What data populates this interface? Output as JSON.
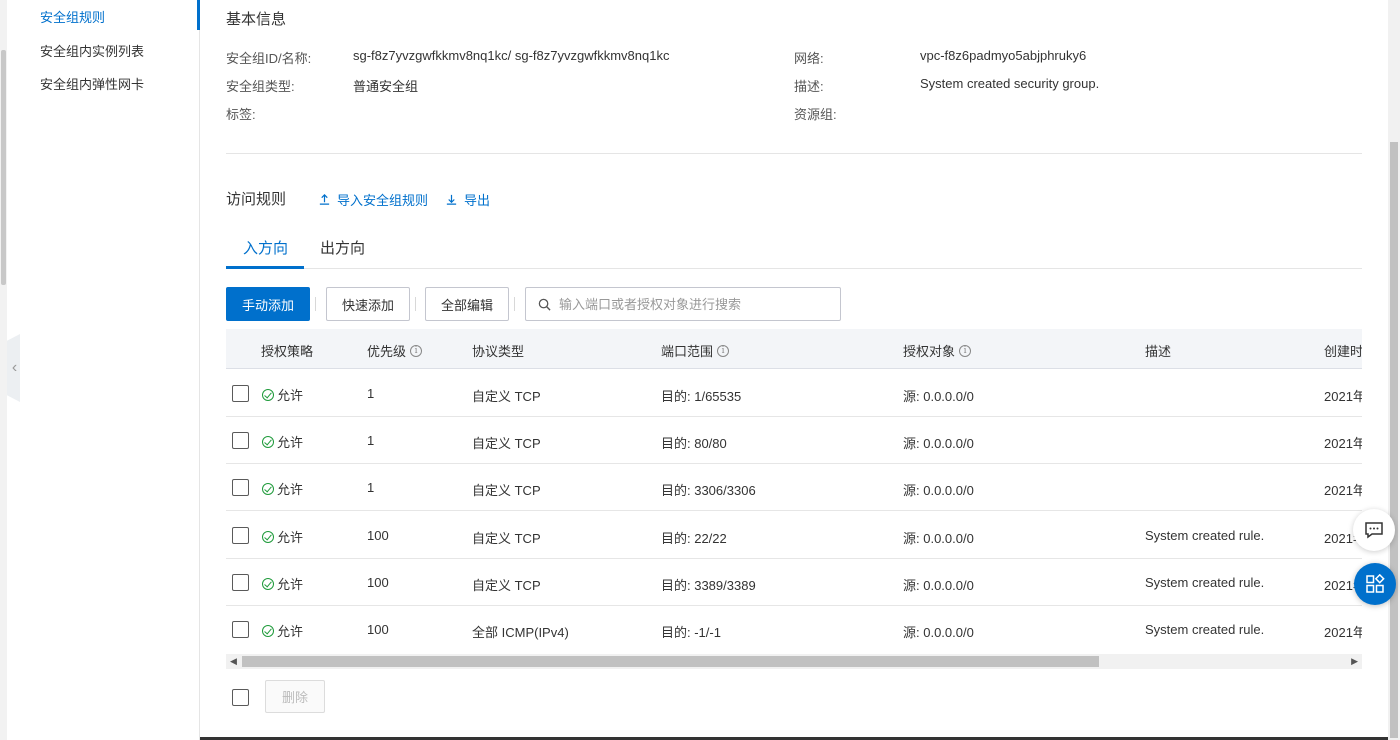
{
  "sidebar": {
    "items": [
      {
        "label": "安全组规则",
        "active": true
      },
      {
        "label": "安全组内实例列表",
        "active": false
      },
      {
        "label": "安全组内弹性网卡",
        "active": false
      }
    ]
  },
  "basic_info": {
    "title": "基本信息",
    "fields": {
      "sg_id_label": "安全组ID/名称:",
      "sg_id_value": "sg-f8z7yvzgwfkkmv8nq1kc/ sg-f8z7yvzgwfkkmv8nq1kc",
      "type_label": "安全组类型:",
      "type_value": "普通安全组",
      "tag_label": "标签:",
      "network_label": "网络:",
      "network_value": "vpc-f8z6padmyo5abjphruky6",
      "desc_label": "描述:",
      "desc_value": "System created security group.",
      "rg_label": "资源组:"
    }
  },
  "rules": {
    "title": "访问规则",
    "import_label": "导入安全组规则",
    "export_label": "导出",
    "tabs": [
      "入方向",
      "出方向"
    ],
    "buttons": {
      "manual_add": "手动添加",
      "quick_add": "快速添加",
      "edit_all": "全部编辑"
    },
    "search_placeholder": "输入端口或者授权对象进行搜索",
    "columns": [
      "授权策略",
      "优先级",
      "协议类型",
      "端口范围",
      "授权对象",
      "描述",
      "创建时"
    ],
    "rows": [
      {
        "policy": "允许",
        "priority": "1",
        "protocol": "自定义 TCP",
        "port": "目的: 1/65535",
        "source": "源: 0.0.0.0/0",
        "desc": "",
        "created": "2021年"
      },
      {
        "policy": "允许",
        "priority": "1",
        "protocol": "自定义 TCP",
        "port": "目的: 80/80",
        "source": "源: 0.0.0.0/0",
        "desc": "",
        "created": "2021年"
      },
      {
        "policy": "允许",
        "priority": "1",
        "protocol": "自定义 TCP",
        "port": "目的: 3306/3306",
        "source": "源: 0.0.0.0/0",
        "desc": "",
        "created": "2021年"
      },
      {
        "policy": "允许",
        "priority": "100",
        "protocol": "自定义 TCP",
        "port": "目的: 22/22",
        "source": "源: 0.0.0.0/0",
        "desc": "System created rule.",
        "created": "2021年"
      },
      {
        "policy": "允许",
        "priority": "100",
        "protocol": "自定义 TCP",
        "port": "目的: 3389/3389",
        "source": "源: 0.0.0.0/0",
        "desc": "System created rule.",
        "created": "2021年"
      },
      {
        "policy": "允许",
        "priority": "100",
        "protocol": "全部 ICMP(IPv4)",
        "port": "目的: -1/-1",
        "source": "源: 0.0.0.0/0",
        "desc": "System created rule.",
        "created": "2021年"
      }
    ],
    "delete_label": "删除"
  },
  "colors": {
    "accent": "#0070cc",
    "success": "#1e9a3a"
  }
}
